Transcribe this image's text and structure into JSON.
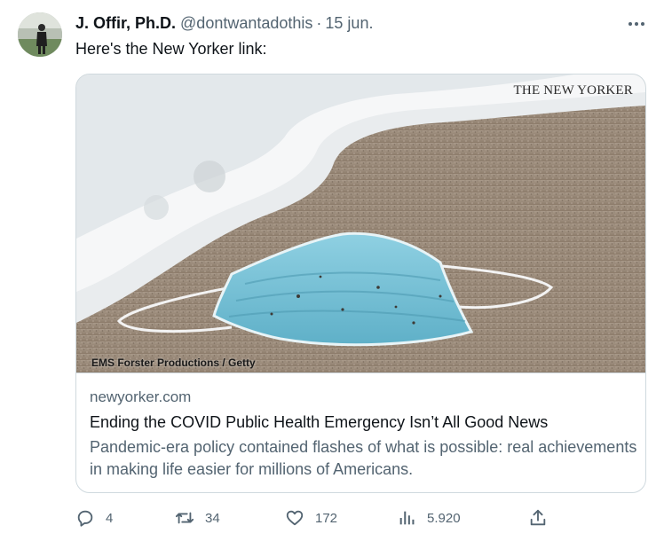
{
  "tweet": {
    "display_name": "J. Offir, Ph.D.",
    "handle": "@dontwantadothis",
    "separator": "·",
    "date": "15 jun.",
    "text": "Here's the New Yorker link:"
  },
  "card": {
    "brand": "THE NEW YORKER",
    "image_credit": "EMS Forster Productions / Getty",
    "domain": "newyorker.com",
    "title": "Ending the COVID Public Health Emergency Isn’t All Good News",
    "description": "Pandemic-era policy contained flashes of what is possible: real achievements in making life easier for millions of Americans."
  },
  "actions": {
    "replies": "4",
    "retweets": "34",
    "likes": "172",
    "views": "5.920"
  },
  "colors": {
    "text_primary": "#0f1419",
    "text_secondary": "#536471",
    "border": "#cfd9de",
    "mask_blue": "#7fc4d6"
  },
  "icons": [
    "more-icon",
    "reply-icon",
    "retweet-icon",
    "like-icon",
    "views-icon",
    "share-icon"
  ]
}
